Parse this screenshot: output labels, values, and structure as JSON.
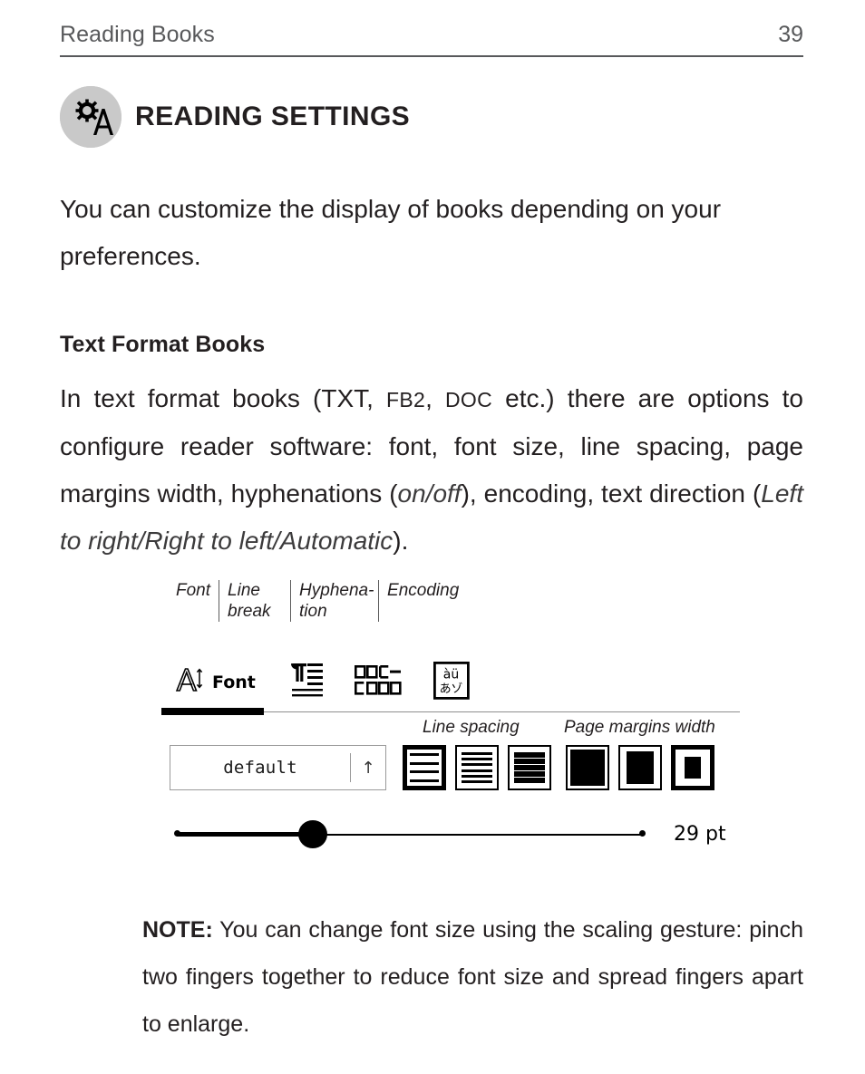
{
  "running_head": {
    "title": "Reading Books",
    "page_number": "39"
  },
  "chapter": {
    "icon": "gear-letter-a-icon",
    "title": "READING SETTINGS"
  },
  "intro_paragraph": "You can customize the display of books depending on your preferences.",
  "section": {
    "subhead": "Text Format Books",
    "paragraph": {
      "part1": "In text format books (TXT, ",
      "fb2": "FB2",
      "part2": ", ",
      "doc": "DOC",
      "part3": " etc.) there are options to configure reader software: font, font size, line spacing, page margins width, hyphenations (",
      "onoff": "on/off",
      "part4": "), encoding, text direction (",
      "direction": "Left to right/Right to left/Automatic",
      "part5": ")."
    }
  },
  "figure": {
    "callouts": [
      {
        "label": "Font",
        "id": "callout-font"
      },
      {
        "label": "Line break",
        "id": "callout-line-break"
      },
      {
        "label": "Hyphena- tion",
        "id": "callout-hyphenation"
      },
      {
        "label": "Encoding",
        "id": "callout-encoding"
      }
    ],
    "callout_labels": {
      "font": "Font",
      "line_break_l1": "Line",
      "line_break_l2": "break",
      "hyphenation_l1": "Hyphena-",
      "hyphenation_l2": "tion",
      "encoding": "Encoding"
    },
    "tabs": [
      {
        "name": "font-tab",
        "label": "Font",
        "icon": "font-size-a-icon",
        "selected": true
      },
      {
        "name": "line-break-tab",
        "label": "",
        "icon": "pilcrow-lines-icon",
        "selected": false
      },
      {
        "name": "hyphenation-tab",
        "label": "",
        "icon": "hyphenation-blocks-icon",
        "selected": false
      },
      {
        "name": "encoding-tab",
        "label": "",
        "icon": "encoding-charset-icon",
        "selected": false
      }
    ],
    "font_tab_label": "Font",
    "group_labels": {
      "line_spacing": "Line spacing",
      "page_margins_width": "Page margins width"
    },
    "font_select": {
      "value": "default",
      "arrow_icon": "arrow-up-icon"
    },
    "line_spacing_options": [
      {
        "name": "line-spacing-wide",
        "lines": 4,
        "selected": true
      },
      {
        "name": "line-spacing-medium",
        "lines": 6,
        "selected": false
      },
      {
        "name": "line-spacing-narrow",
        "lines": 10,
        "selected": false
      }
    ],
    "page_margin_options": [
      {
        "name": "page-margin-narrow",
        "inset": 4,
        "selected": false
      },
      {
        "name": "page-margin-medium",
        "inset": 8,
        "selected": false
      },
      {
        "name": "page-margin-wide",
        "inset": 13,
        "selected": true
      }
    ],
    "font_size_slider": {
      "value_label": "29 pt",
      "value": 29,
      "position_percent": 28
    }
  },
  "note": {
    "prefix": "NOTE:",
    "text": " You can change font size using the scaling gesture: pinch two fingers together to reduce font size and spread fingers apart to enlarge."
  },
  "colors": {
    "text": "#231f20",
    "muted": "#58595b",
    "icon_bg": "#c9c9c9",
    "rule": "#8e8e8e",
    "accent": "#000000"
  }
}
